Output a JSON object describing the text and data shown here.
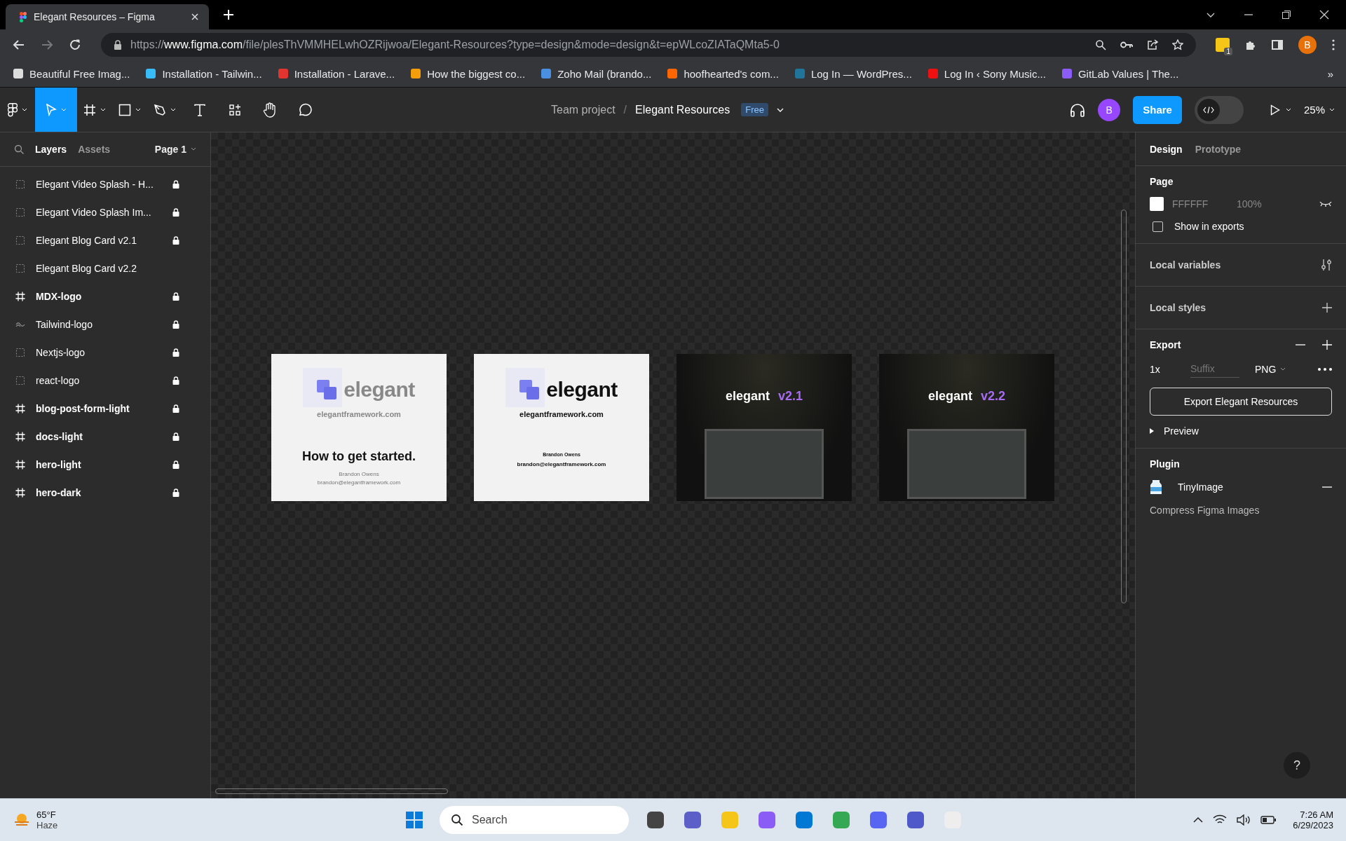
{
  "browser": {
    "tab_title": "Elegant Resources – Figma",
    "url_prefix": "https://",
    "url_host": "www.figma.com",
    "url_rest": "/file/plesThVMMHELwhOZRijwoa/Elegant-Resources?type=design&mode=design&t=epWLcoZIATaQMta5-0",
    "profile": "B",
    "extension_badge": "1",
    "bookmarks": [
      "Beautiful Free Imag...",
      "Installation - Tailwin...",
      "Installation - Larave...",
      "How the biggest co...",
      "Zoho Mail (brando...",
      "hoofhearted's com...",
      "Log In — WordPres...",
      "Log In ‹ Sony Music...",
      "GitLab Values | The..."
    ],
    "more": "»"
  },
  "toolbar": {
    "team": "Team project",
    "separator": "/",
    "file": "Elegant Resources",
    "plan": "Free",
    "avatar": "B",
    "share": "Share",
    "dev_mode": false,
    "zoom": "25%"
  },
  "layers_panel": {
    "tabs": [
      {
        "label": "Layers",
        "selected": true
      },
      {
        "label": "Assets",
        "selected": false
      }
    ],
    "page": "Page 1",
    "layers": [
      {
        "kind": "section",
        "name": "Elegant Video Splash - H...",
        "locked": true
      },
      {
        "kind": "section",
        "name": "Elegant Video Splash Im...",
        "locked": true
      },
      {
        "kind": "section",
        "name": "Elegant Blog Card v2.1",
        "locked": true
      },
      {
        "kind": "section",
        "name": "Elegant Blog Card v2.2",
        "locked": false
      },
      {
        "kind": "frame",
        "name": "MDX-logo",
        "locked": true
      },
      {
        "kind": "component",
        "name": "Tailwind-logo",
        "locked": true
      },
      {
        "kind": "section",
        "name": "Nextjs-logo",
        "locked": true
      },
      {
        "kind": "section",
        "name": "react-logo",
        "locked": true
      },
      {
        "kind": "frame",
        "name": "blog-post-form-light",
        "locked": true
      },
      {
        "kind": "frame",
        "name": "docs-light",
        "locked": true
      },
      {
        "kind": "frame",
        "name": "hero-light",
        "locked": true
      },
      {
        "kind": "frame",
        "name": "hero-dark",
        "locked": true
      }
    ]
  },
  "canvas": {
    "cards": [
      {
        "kind": "faded",
        "logo": "elegant",
        "site": "elegantframework.com",
        "headline": "How to get started.",
        "author": "Brandon Owens",
        "email": "brandon@elegantframework.com"
      },
      {
        "kind": "light",
        "logo": "elegant",
        "site": "elegantframework.com",
        "author": "Brandon Owens",
        "email": "brandon@elegantframework.com"
      },
      {
        "kind": "photo",
        "logo": "elegant",
        "version": "v2.1"
      },
      {
        "kind": "photo",
        "logo": "elegant",
        "version": "v2.2"
      }
    ],
    "help": "?"
  },
  "design_panel": {
    "tabs": [
      {
        "label": "Design",
        "selected": true
      },
      {
        "label": "Prototype",
        "selected": false
      }
    ],
    "page_title": "Page",
    "page_color": "FFFFFF",
    "page_opacity": "100%",
    "show_in_exports": {
      "label": "Show in exports",
      "checked": false
    },
    "local_variables": "Local variables",
    "local_styles": "Local styles",
    "export_title": "Export",
    "export_scale": "1x",
    "export_suffix_placeholder": "Suffix",
    "export_format": "PNG",
    "export_button": "Export Elegant Resources",
    "preview": "Preview",
    "plugin_title": "Plugin",
    "plugin_name": "TinyImage",
    "plugin_action": "Compress Figma Images"
  },
  "taskbar": {
    "temperature": "65°F",
    "weather": "Haze",
    "search_placeholder": "Search",
    "time": "7:26 AM",
    "date": "6/29/2023"
  }
}
